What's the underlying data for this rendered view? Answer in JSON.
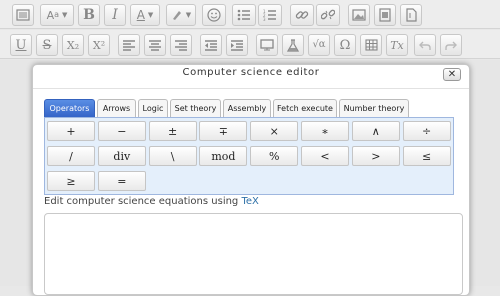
{
  "dialog": {
    "title": "Computer science editor",
    "close_glyph": "✕"
  },
  "tabs": [
    "Operators",
    "Arrows",
    "Logic",
    "Set theory",
    "Assembly",
    "Fetch execute",
    "Number theory"
  ],
  "active_tab": "Operators",
  "keys": [
    "+",
    "−",
    "±",
    "∓",
    "×",
    "∗",
    "∧",
    "÷",
    "/",
    "div",
    "\\",
    "mod",
    "%",
    "<",
    ">",
    "≤",
    "≥",
    "="
  ],
  "help": {
    "text": "Edit computer science equations using ",
    "link": "TeX"
  },
  "toolbar": {
    "row1": [
      "toolbar-toggle-icon",
      "font-family-icon",
      "bold-icon",
      "italic-icon",
      "font-color-icon",
      "highlight-icon",
      "emoticon-icon",
      "bullet-list-icon",
      "numbered-list-icon",
      "link-icon",
      "unlink-icon",
      "image-icon",
      "media-icon",
      "file-icon"
    ],
    "row2": [
      "underline-icon",
      "strikethrough-icon",
      "subscript-icon",
      "superscript-icon",
      "align-left-icon",
      "align-center-icon",
      "align-right-icon",
      "outdent-icon",
      "indent-icon",
      "screen-icon",
      "chemistry-icon",
      "equation-icon",
      "special-character-icon",
      "table-icon",
      "clear-formatting-icon",
      "undo-icon",
      "redo-icon"
    ],
    "bold": "B",
    "italic": "I",
    "underline": "U",
    "strike": "S",
    "subscript": "X₂",
    "superscript": "X²",
    "special_char": "Ω",
    "clear_format": "Tx"
  }
}
